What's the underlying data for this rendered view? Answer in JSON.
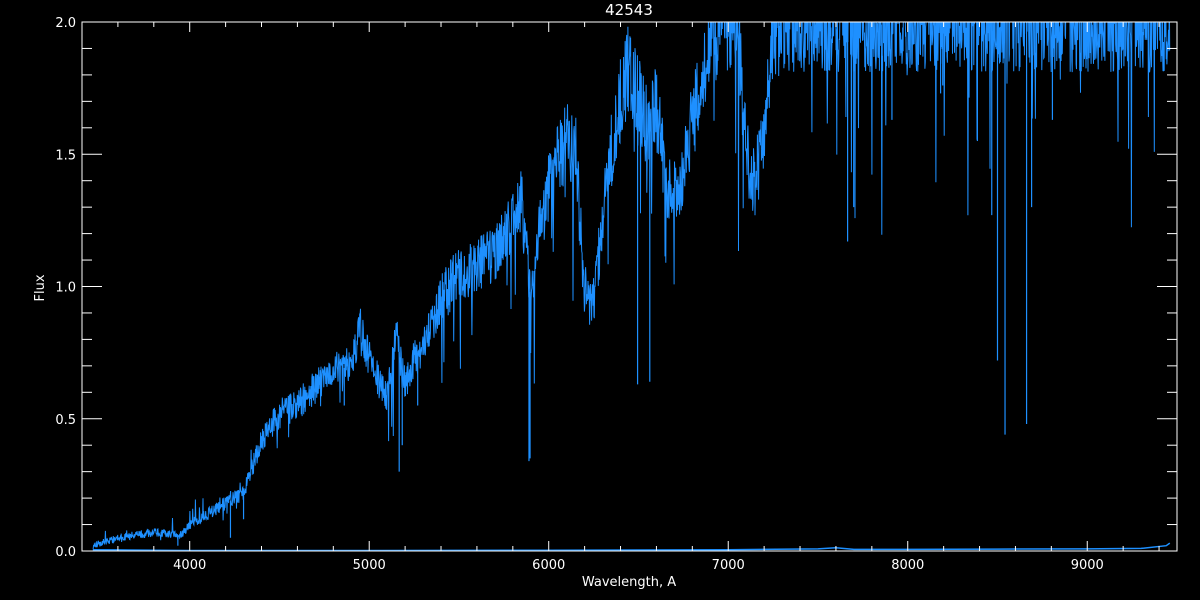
{
  "chart_data": {
    "type": "line",
    "title": "42543",
    "xlabel": "Wavelength, A",
    "ylabel": "Flux",
    "xlim": [
      3400,
      9500
    ],
    "ylim": [
      0,
      2.0
    ],
    "x_major_ticks": [
      4000,
      5000,
      6000,
      7000,
      8000,
      9000
    ],
    "x_tick_labels": [
      "4000",
      "5000",
      "6000",
      "7000",
      "8000",
      "9000"
    ],
    "x_minor_step": 200,
    "y_major_ticks": [
      0,
      0.5,
      1.0,
      1.5,
      2.0
    ],
    "y_tick_labels": [
      "0.0",
      "0.5",
      "1.0",
      "1.5",
      "2.0"
    ],
    "y_minor_step": 0.1,
    "grid": false,
    "colors": {
      "background": "#000000",
      "axes": "#ffffff",
      "series": "#1e90ff"
    },
    "series": [
      {
        "role": "spectrum",
        "continuum_x": [
          3460,
          3600,
          3800,
          3950,
          4000,
          4150,
          4300,
          4400,
          4500,
          4600,
          4700,
          4800,
          4900,
          4950,
          5000,
          5050,
          5100,
          5150,
          5200,
          5250,
          5300,
          5400,
          5500,
          5600,
          5700,
          5800,
          5850,
          5900,
          5950,
          6000,
          6100,
          6150,
          6200,
          6250,
          6300,
          6350,
          6400,
          6450,
          6500,
          6550,
          6600,
          6650,
          6700,
          6750,
          6800,
          6850,
          6900,
          6950,
          7000,
          7050,
          7100,
          7150,
          7200,
          7250,
          7300,
          7400,
          7500,
          9500
        ],
        "continuum_y": [
          0.02,
          0.05,
          0.07,
          0.06,
          0.1,
          0.16,
          0.22,
          0.42,
          0.52,
          0.55,
          0.62,
          0.68,
          0.7,
          0.85,
          0.72,
          0.65,
          0.58,
          0.82,
          0.62,
          0.72,
          0.78,
          0.95,
          1.05,
          1.08,
          1.12,
          1.25,
          1.32,
          0.95,
          1.22,
          1.38,
          1.55,
          1.5,
          0.98,
          0.95,
          1.25,
          1.52,
          1.7,
          1.85,
          1.72,
          1.6,
          1.68,
          1.4,
          1.35,
          1.42,
          1.62,
          1.78,
          1.9,
          2.0,
          2.0,
          2.0,
          1.5,
          1.38,
          1.6,
          1.95,
          2.0,
          2.0,
          2.0,
          2.0
        ],
        "absorption_lines": [
          {
            "x": 3934,
            "y": 0.02
          },
          {
            "x": 4227,
            "y": 0.05
          },
          {
            "x": 4300,
            "y": 0.12
          },
          {
            "x": 4861,
            "y": 0.55
          },
          {
            "x": 5167,
            "y": 0.3
          },
          {
            "x": 5184,
            "y": 0.4
          },
          {
            "x": 5270,
            "y": 0.55
          },
          {
            "x": 5890,
            "y": 0.34
          },
          {
            "x": 5896,
            "y": 0.35
          },
          {
            "x": 6495,
            "y": 0.63
          },
          {
            "x": 6563,
            "y": 0.64
          },
          {
            "x": 7665,
            "y": 1.17
          },
          {
            "x": 7699,
            "y": 1.3
          },
          {
            "x": 7912,
            "y": 1.63
          },
          {
            "x": 8183,
            "y": 1.73
          },
          {
            "x": 8195,
            "y": 1.76
          },
          {
            "x": 8500,
            "y": 0.72
          },
          {
            "x": 8542,
            "y": 0.44
          },
          {
            "x": 8662,
            "y": 0.48
          },
          {
            "x": 8690,
            "y": 1.3
          },
          {
            "x": 8806,
            "y": 1.63
          },
          {
            "x": 8468,
            "y": 1.27
          },
          {
            "x": 8388,
            "y": 1.55
          },
          {
            "x": 9212,
            "y": 1.87
          },
          {
            "x": 9230,
            "y": 1.83
          }
        ]
      },
      {
        "role": "error",
        "x": [
          3460,
          3600,
          4000,
          5000,
          6000,
          7000,
          7500,
          7600,
          7700,
          8000,
          8500,
          9000,
          9300,
          9440,
          9460
        ],
        "y": [
          0.005,
          0.004,
          0.002,
          0.002,
          0.003,
          0.005,
          0.008,
          0.012,
          0.006,
          0.006,
          0.007,
          0.008,
          0.01,
          0.02,
          0.03
        ]
      }
    ]
  }
}
